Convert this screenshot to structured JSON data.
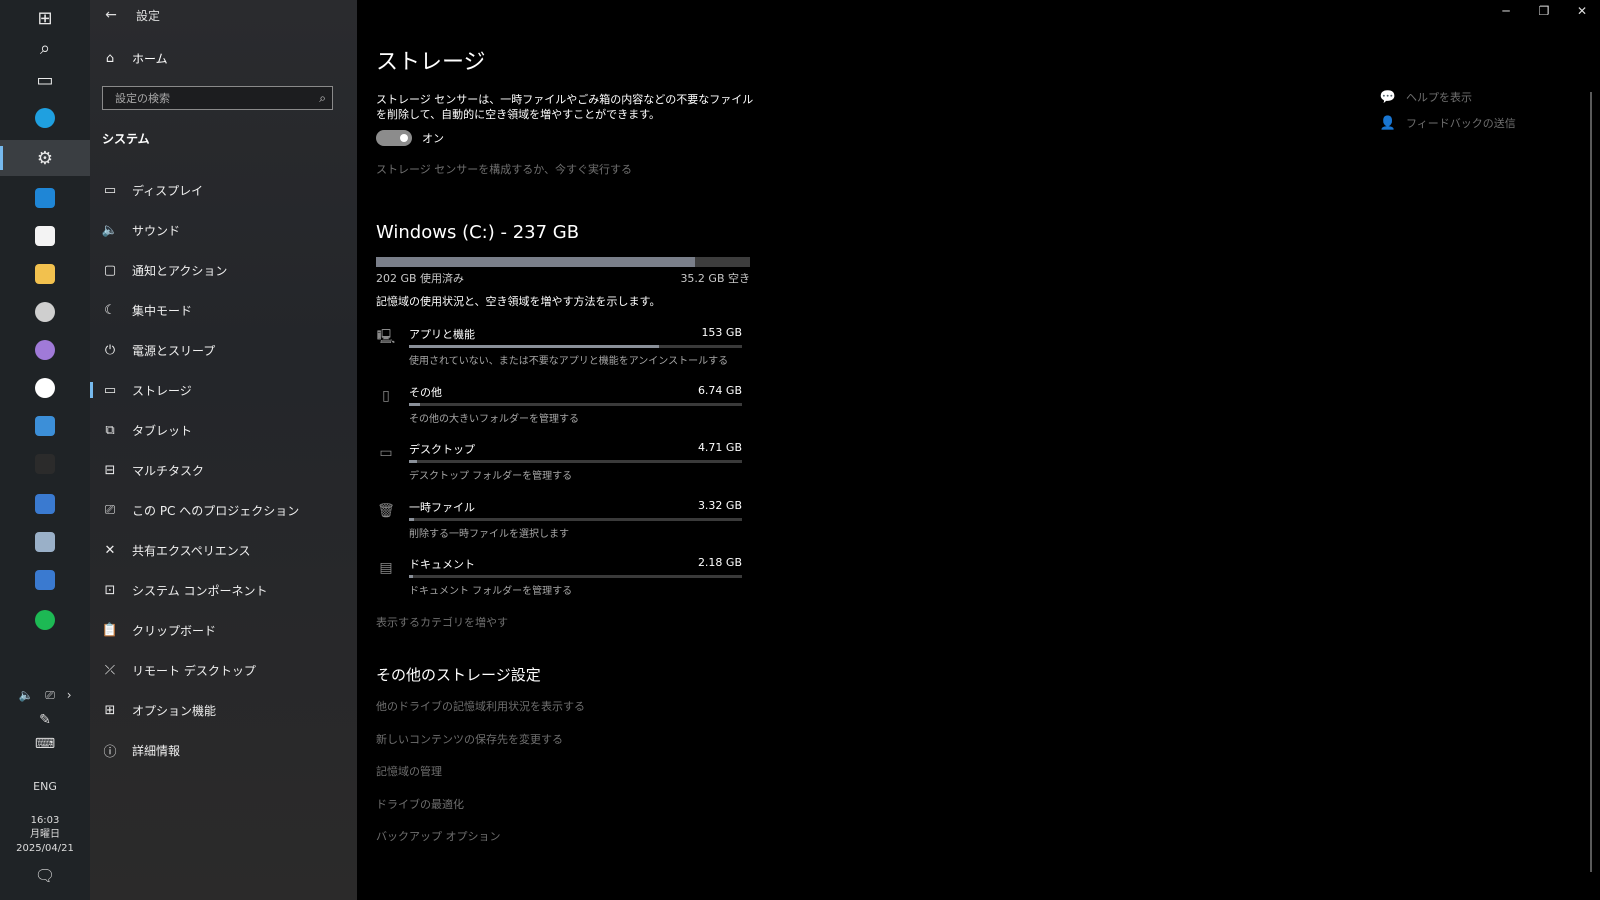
{
  "taskbar": {
    "apps": [
      {
        "name": "windows-start-icon",
        "glyph": "⊞"
      },
      {
        "name": "search-icon",
        "glyph": "⌕"
      },
      {
        "name": "task-view-icon",
        "glyph": "▭"
      },
      {
        "name": "edge-icon",
        "color": "#1fa0e0"
      },
      {
        "name": "settings-gear-icon",
        "glyph": "⚙"
      },
      {
        "name": "mail-icon",
        "color": "#1f86d6"
      },
      {
        "name": "store-icon",
        "color": "#f3f3f3"
      },
      {
        "name": "file-explorer-icon",
        "color": "#f2c14e"
      },
      {
        "name": "app-swirl-icon",
        "color": "#cfcfcf"
      },
      {
        "name": "app-rainbow-icon",
        "color": "#a07ad8"
      },
      {
        "name": "chatgpt-icon",
        "color": "#ffffff"
      },
      {
        "name": "outlook-icon",
        "color": "#3c8fd8"
      },
      {
        "name": "terminal-icon",
        "color": "#2b2b2b"
      },
      {
        "name": "remote-desktop-icon",
        "color": "#3a7ad0"
      },
      {
        "name": "photos-icon",
        "color": "#9ab0c8"
      },
      {
        "name": "app-window-icon",
        "color": "#3a7ad0"
      },
      {
        "name": "spotify-icon",
        "color": "#1db954"
      }
    ],
    "tray": {
      "lang": "ENG",
      "time": "16:03",
      "day": "月曜日",
      "date": "2025/04/21"
    }
  },
  "nav": {
    "window_title": "設定",
    "home": "ホーム",
    "search_placeholder": "設定の検索",
    "section": "システム",
    "items": [
      {
        "label": "ディスプレイ",
        "icon": "display-icon",
        "glyph": "▭"
      },
      {
        "label": "サウンド",
        "icon": "sound-icon",
        "glyph": "🔈"
      },
      {
        "label": "通知とアクション",
        "icon": "notification-icon",
        "glyph": "▢"
      },
      {
        "label": "集中モード",
        "icon": "focus-moon-icon",
        "glyph": "☾"
      },
      {
        "label": "電源とスリープ",
        "icon": "power-icon",
        "glyph": "⏻"
      },
      {
        "label": "ストレージ",
        "icon": "storage-icon",
        "glyph": "▭"
      },
      {
        "label": "タブレット",
        "icon": "tablet-icon",
        "glyph": "⧉"
      },
      {
        "label": "マルチタスク",
        "icon": "multitask-icon",
        "glyph": "⊟"
      },
      {
        "label": "この PC へのプロジェクション",
        "icon": "projection-icon",
        "glyph": "⎚"
      },
      {
        "label": "共有エクスペリエンス",
        "icon": "shared-experiences-icon",
        "glyph": "✕"
      },
      {
        "label": "システム コンポーネント",
        "icon": "system-components-icon",
        "glyph": "⊡"
      },
      {
        "label": "クリップボード",
        "icon": "clipboard-icon",
        "glyph": "📋"
      },
      {
        "label": "リモート デスクトップ",
        "icon": "remote-desktop-icon",
        "glyph": "⤫"
      },
      {
        "label": "オプション機能",
        "icon": "optional-features-icon",
        "glyph": "⊞"
      },
      {
        "label": "詳細情報",
        "icon": "info-icon",
        "glyph": "ⓘ"
      }
    ]
  },
  "main": {
    "title": "ストレージ",
    "description": "ストレージ センサーは、一時ファイルやごみ箱の内容などの不要なファイルを削除して、自動的に空き領域を増やすことができます。",
    "toggle_label": "オン",
    "toggle_on": true,
    "sense_link": "ストレージ センサーを構成するか、今すぐ実行する",
    "drive": {
      "title": "Windows (C:) - 237 GB",
      "used": "202 GB 使用済み",
      "free": "35.2 GB 空き",
      "used_fraction": 0.852
    },
    "usage_description": "記憶域の使用状況と、空き領域を増やす方法を示します。",
    "categories": [
      {
        "name": "アプリと機能",
        "size": "153 GB",
        "sub": "使用されていない、または不要なアプリと機能をアンインストールする",
        "fraction": 0.75,
        "icon": "apps-icon",
        "glyph": "🖳"
      },
      {
        "name": "その他",
        "size": "6.74 GB",
        "sub": "その他の大きいフォルダーを管理する",
        "fraction": 0.033,
        "icon": "other-file-icon",
        "glyph": "▯"
      },
      {
        "name": "デスクトップ",
        "size": "4.71 GB",
        "sub": "デスクトップ フォルダーを管理する",
        "fraction": 0.023,
        "icon": "desktop-icon",
        "glyph": "▭"
      },
      {
        "name": "一時ファイル",
        "size": "3.32 GB",
        "sub": "削除する一時ファイルを選択します",
        "fraction": 0.016,
        "icon": "trash-icon",
        "glyph": "🗑"
      },
      {
        "name": "ドキュメント",
        "size": "2.18 GB",
        "sub": "ドキュメント フォルダーを管理する",
        "fraction": 0.011,
        "icon": "documents-icon",
        "glyph": "▤"
      }
    ],
    "more_categories": "表示するカテゴリを増やす",
    "other_title": "その他のストレージ設定",
    "other_links": [
      "他のドライブの記憶域利用状況を表示する",
      "新しいコンテンツの保存先を変更する",
      "記憶域の管理",
      "ドライブの最適化",
      "バックアップ オプション"
    ],
    "side_links": [
      {
        "label": "ヘルプを表示",
        "icon": "help-icon",
        "glyph": "💬"
      },
      {
        "label": "フィードバックの送信",
        "icon": "feedback-icon",
        "glyph": "👤"
      }
    ]
  }
}
